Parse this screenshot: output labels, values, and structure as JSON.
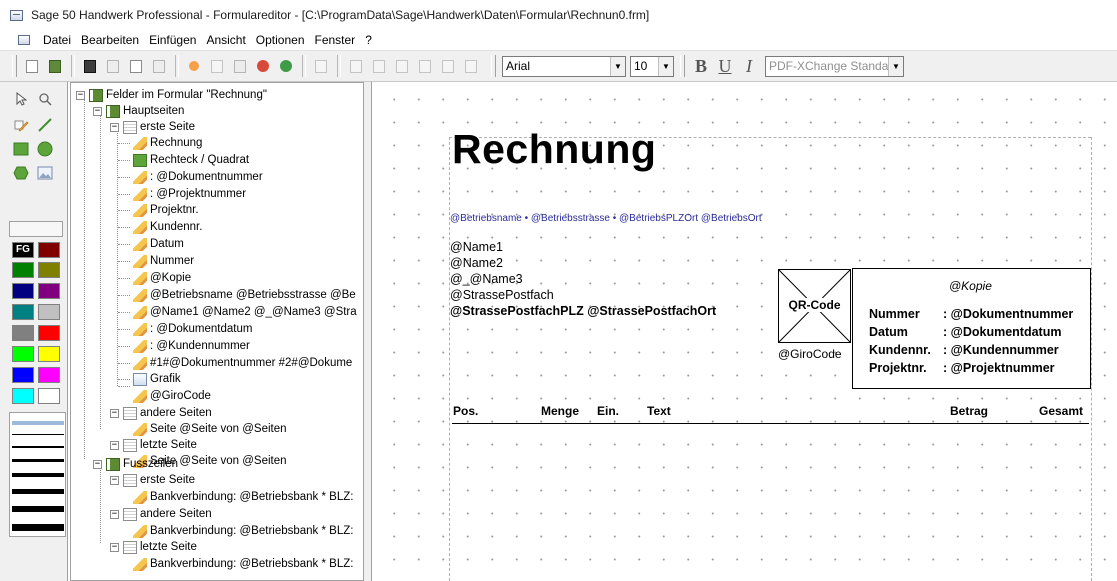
{
  "window": {
    "title": "Sage 50 Handwerk Professional - Formulareditor - [C:\\ProgramData\\Sage\\Handwerk\\Daten\\Formular\\Rechnun0.frm]"
  },
  "menu": [
    "Datei",
    "Bearbeiten",
    "Einfügen",
    "Ansicht",
    "Optionen",
    "Fenster",
    "?"
  ],
  "toolbar": {
    "font": "Arial",
    "size": "10",
    "bold_label": "B",
    "underline_label": "U",
    "italic_label": "I",
    "printer": "PDF-XChange Standa"
  },
  "palette": {
    "fg_label": "FG",
    "colors": [
      "#800000",
      "#008000",
      "#808000",
      "#000080",
      "#800080",
      "#008080",
      "#c0c0c0",
      "#808080",
      "#ff0000",
      "#00ff00",
      "#ffff00",
      "#0000ff",
      "#ff00ff",
      "#00ffff",
      "#ffffff"
    ]
  },
  "tree": {
    "root": "Felder im Formular \"Rechnung\"",
    "hauptseiten": "Hauptseiten",
    "erste_seite": "erste Seite",
    "items_erste": [
      "Rechnung",
      "Rechteck / Quadrat",
      ": @Dokumentnummer",
      ": @Projektnummer",
      "Projektnr.",
      "Kundennr.",
      "Datum",
      "Nummer",
      "@Kopie",
      "@Betriebsname  @Betriebsstrasse  @Be",
      "@Name1 @Name2 @_@Name3 @Stra",
      ": @Dokumentdatum",
      ": @Kundennummer",
      "#1#@Dokumentnummer #2#@Dokume",
      "Grafik",
      "@GiroCode"
    ],
    "andere_seiten": "andere Seiten",
    "andere_item": "Seite @Seite von @Seiten",
    "letzte_seite": "letzte Seite",
    "letzte_item": "Seite @Seite von @Seiten",
    "fusszeilen": "Fusszeilen",
    "fuss_erste": "erste Seite",
    "fuss_erste_item": "Bankverbindung: @Betriebsbank * BLZ:",
    "fuss_andere": "andere Seiten",
    "fuss_andere_item": "Bankverbindung: @Betriebsbank * BLZ:",
    "fuss_letzte": "letzte Seite",
    "fuss_letzte_item": "Bankverbindung: @Betriebsbank * BLZ:"
  },
  "document": {
    "heading": "Rechnung",
    "absender": "@Betriebsname • @Betriebsstrasse • @BetriebsPLZOrt @BetriebsOrt",
    "address": [
      "@Name1",
      "@Name2",
      "@_@Name3",
      "@StrassePostfach"
    ],
    "address_bold": "@StrassePostfachPLZ @StrassePostfachOrt",
    "qr_label": "QR-Code",
    "girocode": "@GiroCode",
    "kopie": "@Kopie",
    "info": [
      {
        "label": "Nummer",
        "value": ": @Dokumentnummer"
      },
      {
        "label": "Datum",
        "value": ": @Dokumentdatum"
      },
      {
        "label": "Kundennr.",
        "value": ": @Kundennummer"
      },
      {
        "label": "Projektnr.",
        "value": ": @Projektnummer"
      }
    ],
    "columns": {
      "pos": "Pos.",
      "menge": "Menge",
      "ein": "Ein.",
      "text": "Text",
      "betrag": "Betrag",
      "gesamt": "Gesamt"
    }
  }
}
